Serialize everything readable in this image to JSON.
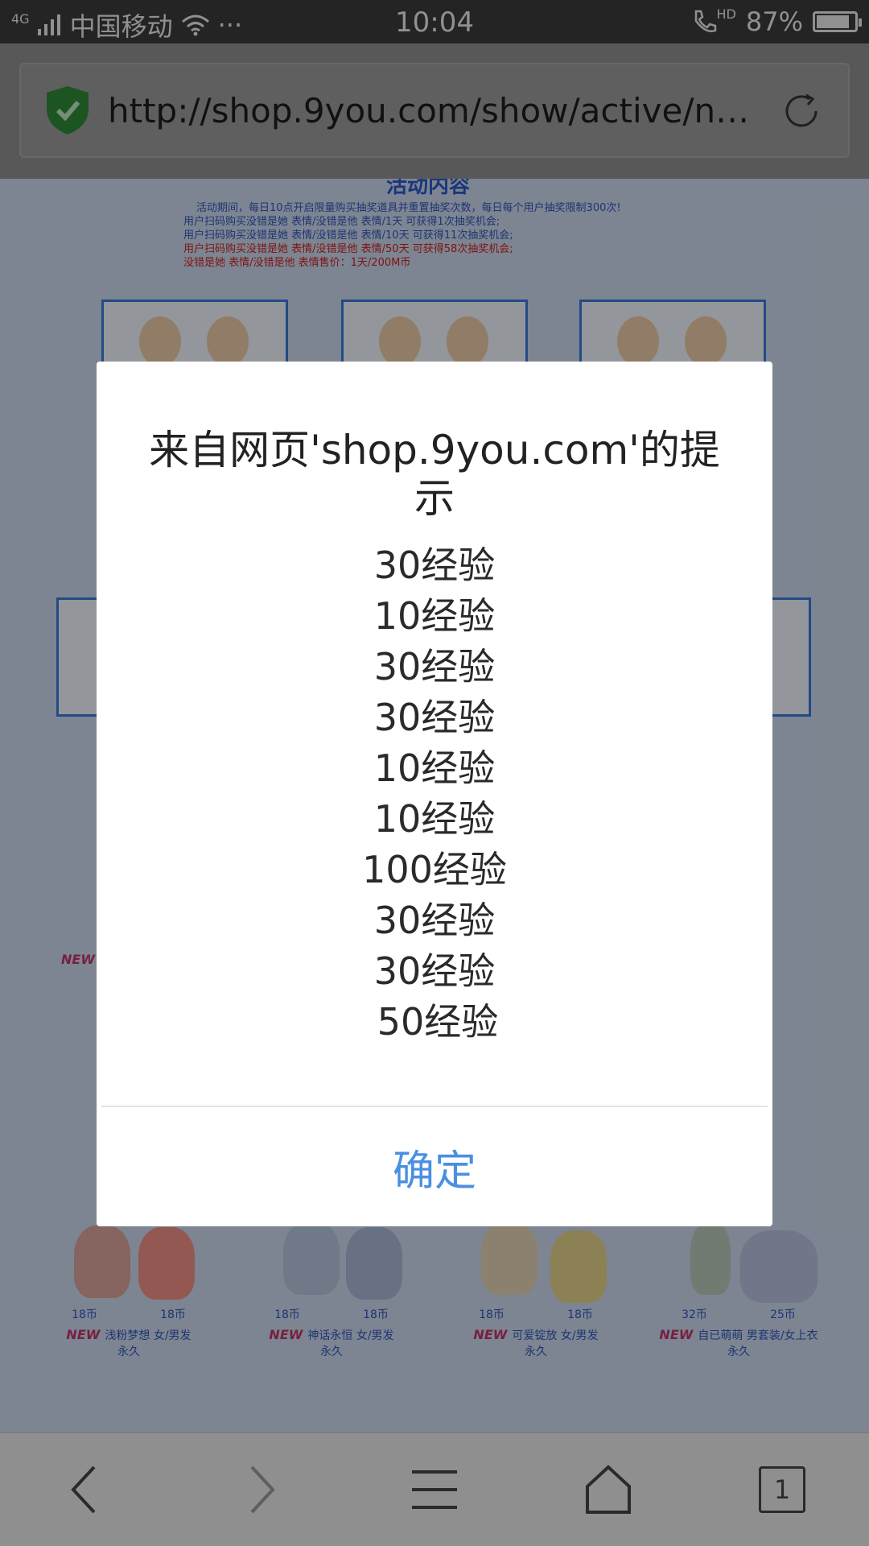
{
  "status_bar": {
    "network": "4G",
    "carrier": "中国移动",
    "more": "···",
    "time": "10:04",
    "hd": "HD",
    "battery_percent": "87%",
    "battery_level": 0.87
  },
  "browser": {
    "url": "http://shop.9you.com/show/active/name/...",
    "tab_count": "1"
  },
  "page": {
    "heading": "活动内容",
    "info_lines": [
      "活动期间，每日10点开启限量购买抽奖道具并重置抽奖次数，每日每个用户抽奖限制300次!",
      "用户扫码购买没错是她 表情/没错是他 表情/1天 可获得1次抽奖机会;",
      "用户扫码购买没错是她 表情/没错是他 表情/10天 可获得11次抽奖机会;",
      "用户扫码购买没错是她 表情/没错是他 表情/50天 可获得58次抽奖机会;",
      "没错是她 表情/没错是他 表情售价：1天/200M币"
    ],
    "new_badge": "NEW",
    "products": [
      {
        "price1": "18币",
        "price2": "18币",
        "name": "浅粉梦想 女/男发",
        "duration": "永久"
      },
      {
        "price1": "18币",
        "price2": "18币",
        "name": "神话永恒 女/男发",
        "duration": "永久"
      },
      {
        "price1": "18币",
        "price2": "18币",
        "name": "可爱锭放 女/男发",
        "duration": "永久"
      },
      {
        "price1": "32币",
        "price2": "25币",
        "name": "自已萌萌 男套装/女上衣",
        "duration": "永久"
      }
    ]
  },
  "dialog": {
    "title": "来自网页'shop.9you.com'的提示",
    "lines": [
      "30经验",
      "10经验",
      "30经验",
      "30经验",
      "10经验",
      "10经验",
      "100经验",
      "30经验",
      "30经验",
      "50经验"
    ],
    "ok_label": "确定"
  },
  "colors": {
    "accent": "#4a90e2",
    "status_bar": "#3b3b3b",
    "shield": "#3aa843"
  }
}
